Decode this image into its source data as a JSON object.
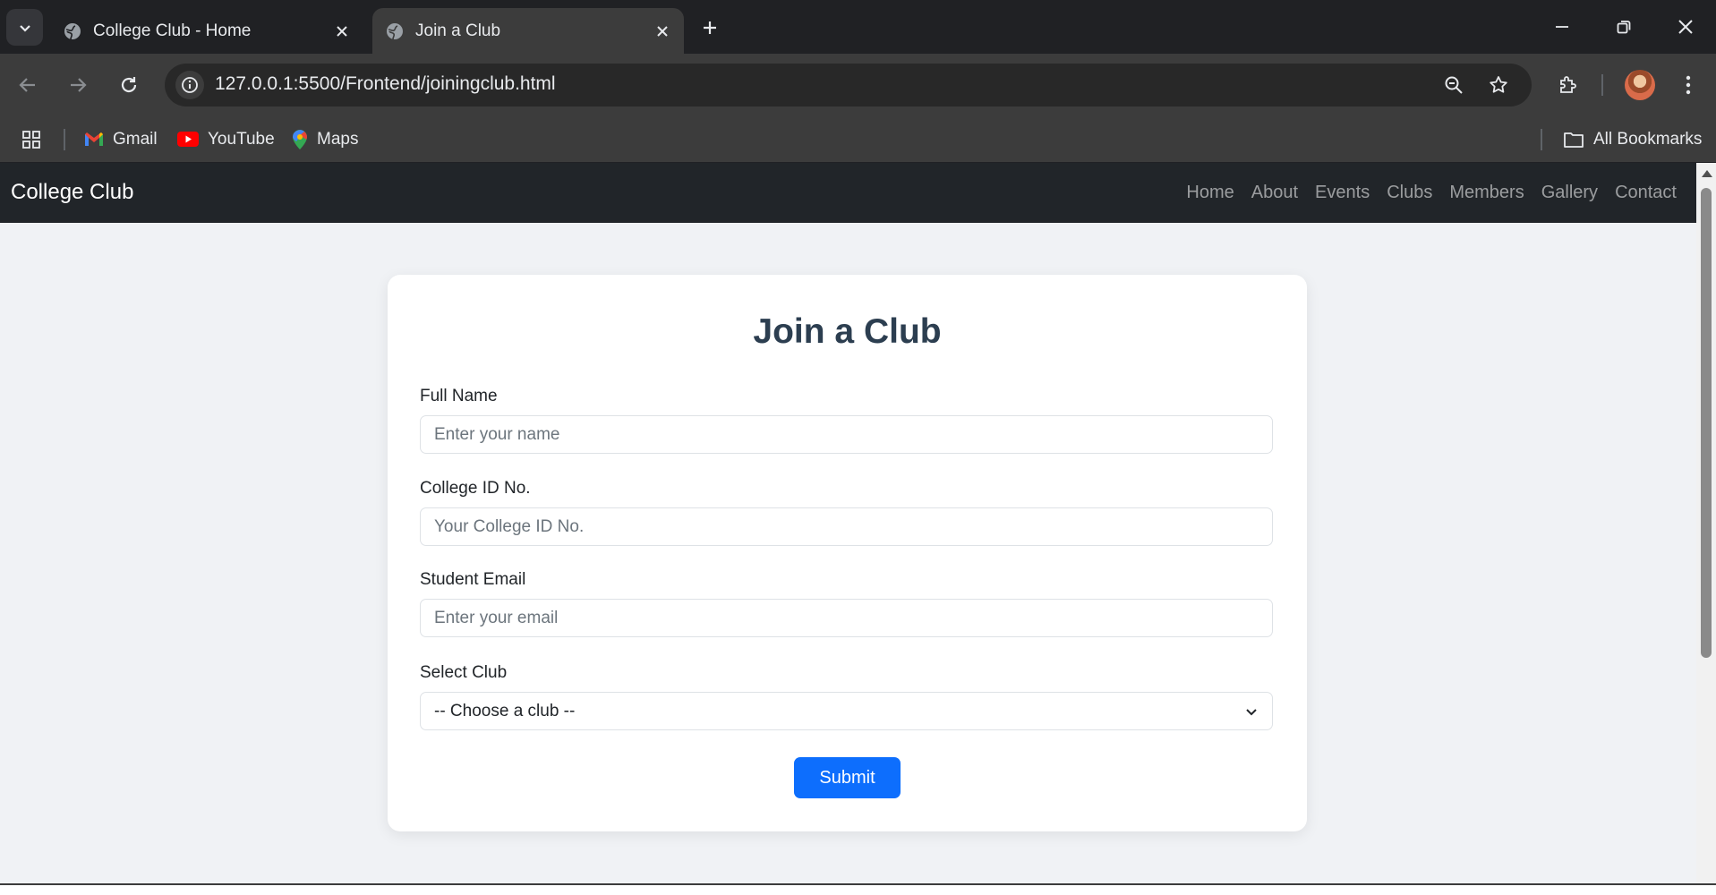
{
  "browser": {
    "tabs": [
      {
        "title": "College Club - Home",
        "active": false
      },
      {
        "title": "Join a Club",
        "active": true
      }
    ],
    "url": "127.0.0.1:5500/Frontend/joiningclub.html",
    "bookmarks": [
      {
        "label": "Gmail",
        "icon": "gmail-icon"
      },
      {
        "label": "YouTube",
        "icon": "youtube-icon"
      },
      {
        "label": "Maps",
        "icon": "maps-icon"
      }
    ],
    "all_bookmarks_label": "All Bookmarks"
  },
  "navbar": {
    "brand": "College Club",
    "links": [
      "Home",
      "About",
      "Events",
      "Clubs",
      "Members",
      "Gallery",
      "Contact"
    ]
  },
  "form": {
    "title": "Join a Club",
    "full_name": {
      "label": "Full Name",
      "placeholder": "Enter your name"
    },
    "college_id": {
      "label": "College ID No.",
      "placeholder": "Your College ID No."
    },
    "email": {
      "label": "Student Email",
      "placeholder": "Enter your email"
    },
    "club": {
      "label": "Select Club",
      "selected": "-- Choose a club --"
    },
    "submit_label": "Submit"
  },
  "colors": {
    "navbar_bg": "#212529",
    "page_bg": "#f0f2f5",
    "title": "#2c3e50",
    "primary_button": "#0d6efd"
  }
}
